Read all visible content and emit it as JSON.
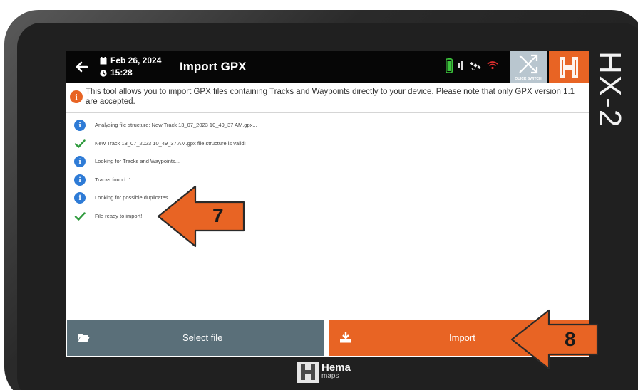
{
  "device": {
    "model_label": "HX-2",
    "footer_brand": "Hema",
    "footer_sub": "maps"
  },
  "topbar": {
    "date": "Feb 26, 2024",
    "time": "15:28",
    "title": "Import GPX",
    "quick_switch_label": "QUICK SWITCH"
  },
  "notice": {
    "text": "This tool allows you to import GPX files containing Tracks and Waypoints directly to your device. Please note that only GPX version 1.1 are accepted."
  },
  "log": [
    {
      "type": "info",
      "text": "Analysing file structure: New Track 13_07_2023 10_49_37 AM.gpx..."
    },
    {
      "type": "success",
      "text": "New Track 13_07_2023 10_49_37 AM.gpx file structure is valid!"
    },
    {
      "type": "info",
      "text": "Looking for Tracks and Waypoints..."
    },
    {
      "type": "info",
      "text": "Tracks found: 1"
    },
    {
      "type": "info",
      "text": "Looking for possible duplicates..."
    },
    {
      "type": "success",
      "text": "File ready to import!"
    }
  ],
  "buttons": {
    "select_file": "Select file",
    "import": "Import"
  },
  "callouts": {
    "step7": "7",
    "step8": "8"
  },
  "colors": {
    "accent_orange": "#e86424",
    "info_blue": "#2e7bd6",
    "success_green": "#2e9a3c",
    "select_button": "#5a6f79",
    "topbar": "#060606"
  }
}
